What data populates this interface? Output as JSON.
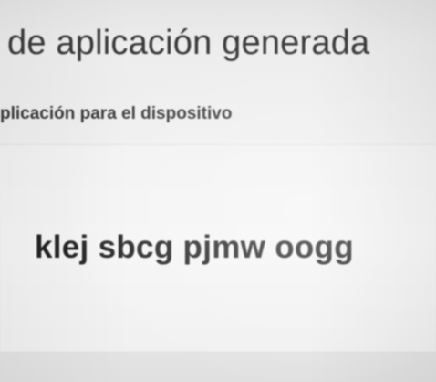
{
  "dialog": {
    "title": "de aplicación generada",
    "field_label": "plicación para el dispositivo",
    "app_password": "klej sbcg pjmw oogg"
  }
}
